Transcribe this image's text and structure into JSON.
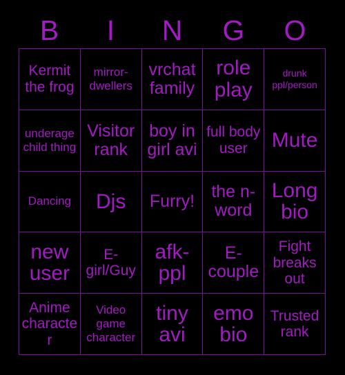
{
  "card": {
    "title": "BINGO",
    "text_color": "#a31bc4",
    "grid_line_color": "#7a139b",
    "background_color": "#000000"
  },
  "header": {
    "letters": [
      "B",
      "I",
      "N",
      "G",
      "O"
    ]
  },
  "grid": {
    "rows": 5,
    "columns": 5,
    "cells": [
      {
        "text": "Kermit the frog",
        "size": "m"
      },
      {
        "text": "mirror-dwellers",
        "size": "s"
      },
      {
        "text": "vrchat family",
        "size": "l"
      },
      {
        "text": "role play",
        "size": "xl"
      },
      {
        "text": "drunk ppl/person",
        "size": "xs"
      },
      {
        "text": "underage child thing",
        "size": "s"
      },
      {
        "text": "Visitor rank",
        "size": "l"
      },
      {
        "text": "boy in girl avi",
        "size": "l"
      },
      {
        "text": "full body user",
        "size": "m"
      },
      {
        "text": "Mute",
        "size": "xl"
      },
      {
        "text": "Dancing",
        "size": "s"
      },
      {
        "text": "Djs",
        "size": "xl"
      },
      {
        "text": "Furry!",
        "size": "l"
      },
      {
        "text": "the n-word",
        "size": "l"
      },
      {
        "text": "Long bio",
        "size": "xl"
      },
      {
        "text": "new user",
        "size": "xl"
      },
      {
        "text": "E-girl/Guy",
        "size": "m"
      },
      {
        "text": "afk-ppl",
        "size": "xl"
      },
      {
        "text": "E-couple",
        "size": "l"
      },
      {
        "text": "Fight breaks out",
        "size": "m"
      },
      {
        "text": "Anime character",
        "size": "m"
      },
      {
        "text": "Video game character",
        "size": "s"
      },
      {
        "text": "tiny avi",
        "size": "xl"
      },
      {
        "text": "emo bio",
        "size": "xl"
      },
      {
        "text": "Trusted rank",
        "size": "m"
      }
    ]
  }
}
